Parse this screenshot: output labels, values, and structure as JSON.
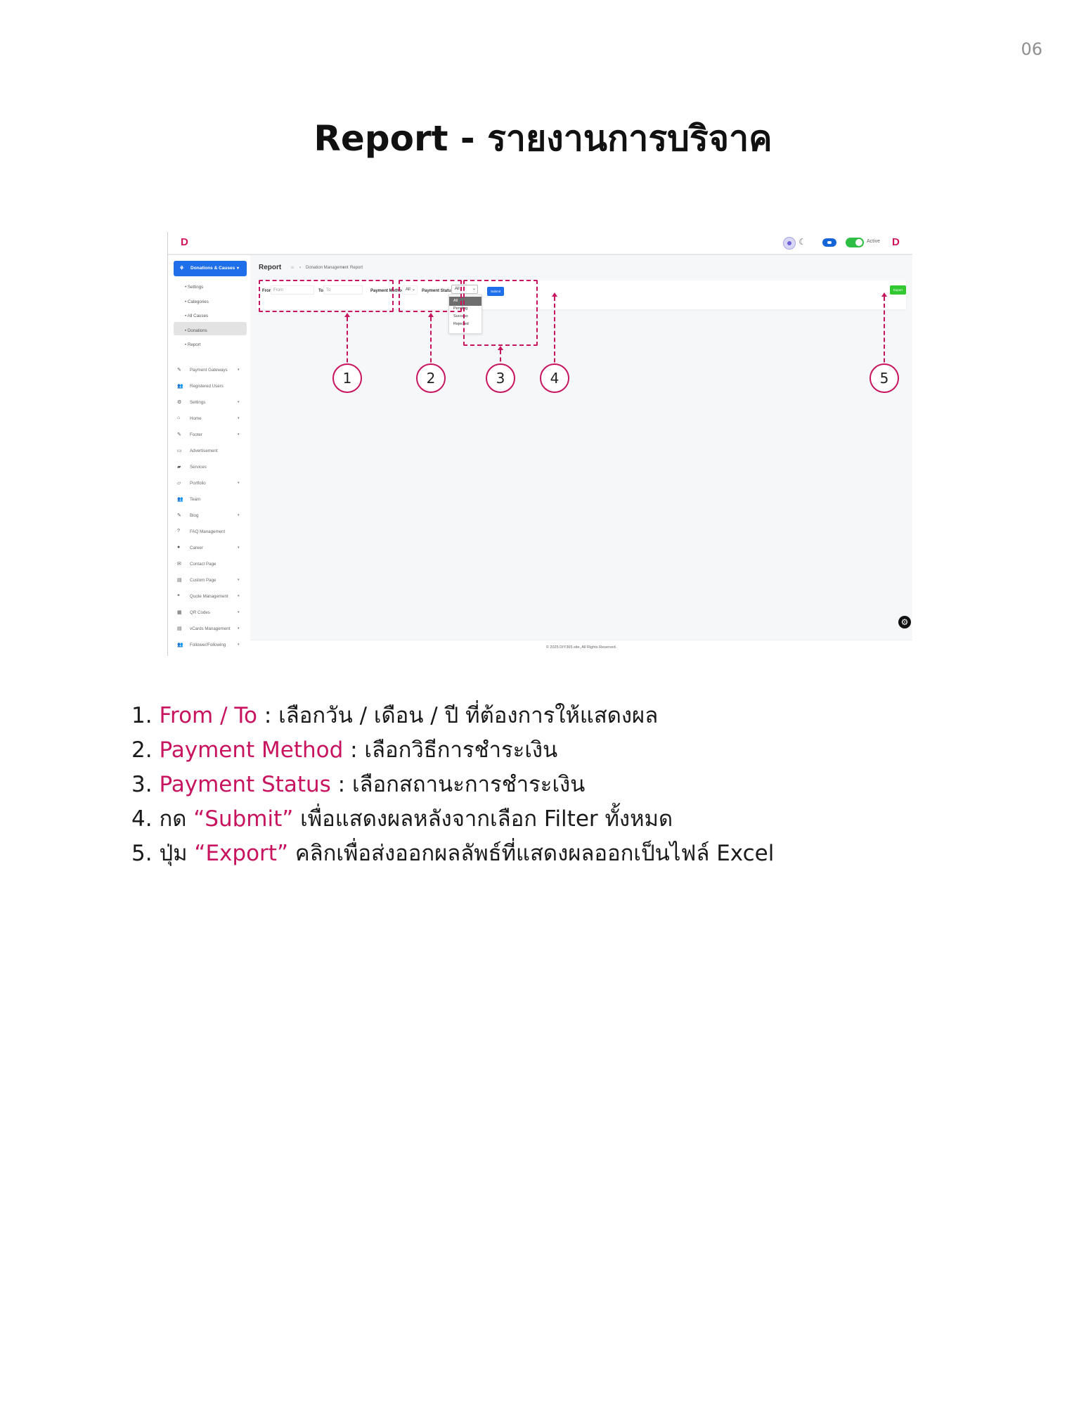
{
  "page_number": "06",
  "title": "Report - รายงานการบริจาค",
  "screenshot": {
    "logo": "D",
    "topbar": {
      "active_label": "Active"
    },
    "sidebar": {
      "active_menu": "Donations & Causes",
      "submenu": [
        "Settings",
        "Categories",
        "All Causes",
        "Donations",
        "Report"
      ],
      "items": [
        {
          "label": "Payment Gateways",
          "icon": "✎",
          "has_chevron": true
        },
        {
          "label": "Registered Users",
          "icon": "👥",
          "has_chevron": false
        },
        {
          "label": "Settings",
          "icon": "⚙",
          "has_chevron": true
        },
        {
          "label": "Home",
          "icon": "⌂",
          "has_chevron": true
        },
        {
          "label": "Footer",
          "icon": "✎",
          "has_chevron": true
        },
        {
          "label": "Advertisement",
          "icon": "▭",
          "has_chevron": false
        },
        {
          "label": "Services",
          "icon": "▰",
          "has_chevron": false
        },
        {
          "label": "Portfolio",
          "icon": "▱",
          "has_chevron": true
        },
        {
          "label": "Team",
          "icon": "👥",
          "has_chevron": false
        },
        {
          "label": "Blog",
          "icon": "✎",
          "has_chevron": true
        },
        {
          "label": "FAQ Management",
          "icon": "?",
          "has_chevron": false
        },
        {
          "label": "Career",
          "icon": "●",
          "has_chevron": true
        },
        {
          "label": "Contact Page",
          "icon": "✉",
          "has_chevron": false
        },
        {
          "label": "Custom Page",
          "icon": "▤",
          "has_chevron": true
        },
        {
          "label": "Quote Management",
          "icon": "❝",
          "has_chevron": true
        },
        {
          "label": "QR Codes",
          "icon": "▦",
          "has_chevron": true
        },
        {
          "label": "vCards Management",
          "icon": "▤",
          "has_chevron": true
        },
        {
          "label": "Follower/Following",
          "icon": "👥",
          "has_chevron": true
        }
      ]
    },
    "page_title": "Report",
    "breadcrumb": [
      "Donation Management",
      "Report"
    ],
    "filters": {
      "from_label": "From",
      "from_placeholder": "From",
      "to_label": "To",
      "to_placeholder": "To",
      "payment_method_label": "Payment Method",
      "payment_method_value": "All",
      "payment_status_label": "Payment Status",
      "payment_status_value": "All",
      "payment_status_options": [
        "All",
        "Pending",
        "Success",
        "Rejected"
      ],
      "submit_label": "Submit",
      "export_label": "Export"
    },
    "footer": "© 2025 DIY365.site, All Rights Reserved."
  },
  "callouts": [
    "1",
    "2",
    "3",
    "4",
    "5"
  ],
  "instructions": [
    {
      "num": "1.",
      "highlight": "From / To",
      "text": " : เลือกวัน / เดือน / ปี ที่ต้องการให้แสดงผล"
    },
    {
      "num": "2.",
      "highlight": "Payment Method",
      "text": " : เลือกวิธีการชำระเงิน"
    },
    {
      "num": "3.",
      "highlight": "Payment Status",
      "text": " : เลือกสถานะการชำระเงิน"
    },
    {
      "num": "4.",
      "prefix": "กด ",
      "highlight": "“Submit”",
      "text": " เพื่อแสดงผลหลังจากเลือก Filter ทั้งหมด"
    },
    {
      "num": "5.",
      "prefix": "ปุ่ม ",
      "highlight": "“Export”",
      "text": " คลิกเพื่อส่งออกผลลัพธ์ที่แสดงผลออกเป็นไฟล์ Excel"
    }
  ],
  "colors": {
    "accent": "#c8135f",
    "primary_button": "#1f6feb",
    "export_button": "#32c832"
  }
}
